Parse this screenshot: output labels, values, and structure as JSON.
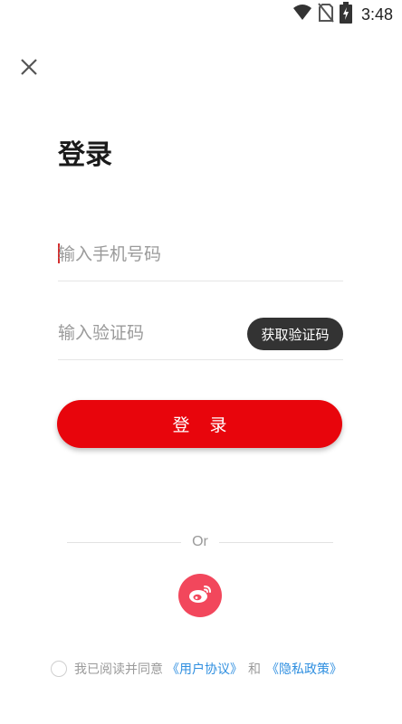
{
  "status_bar": {
    "time": "3:48",
    "icons": [
      "wifi-icon",
      "no-sim-icon",
      "battery-charging-icon"
    ]
  },
  "header": {
    "close_icon": "close-icon"
  },
  "title": "登录",
  "phone_field": {
    "placeholder": "输入手机号码",
    "value": ""
  },
  "code_field": {
    "placeholder": "输入验证码",
    "value": "",
    "get_code_label": "获取验证码"
  },
  "login_button_label": "登 录",
  "divider_label": "Or",
  "social_login": {
    "icon": "weibo-icon",
    "color": "#f2475c"
  },
  "agreement": {
    "checked": false,
    "text": "我已阅读并同意",
    "user_agreement_link": "《用户协议》",
    "and_text": "和",
    "privacy_policy_link": "《隐私政策》"
  },
  "colors": {
    "primary": "#e8050c",
    "dark_button": "#333333",
    "link": "#2f8fe0",
    "weibo": "#f2475c"
  }
}
